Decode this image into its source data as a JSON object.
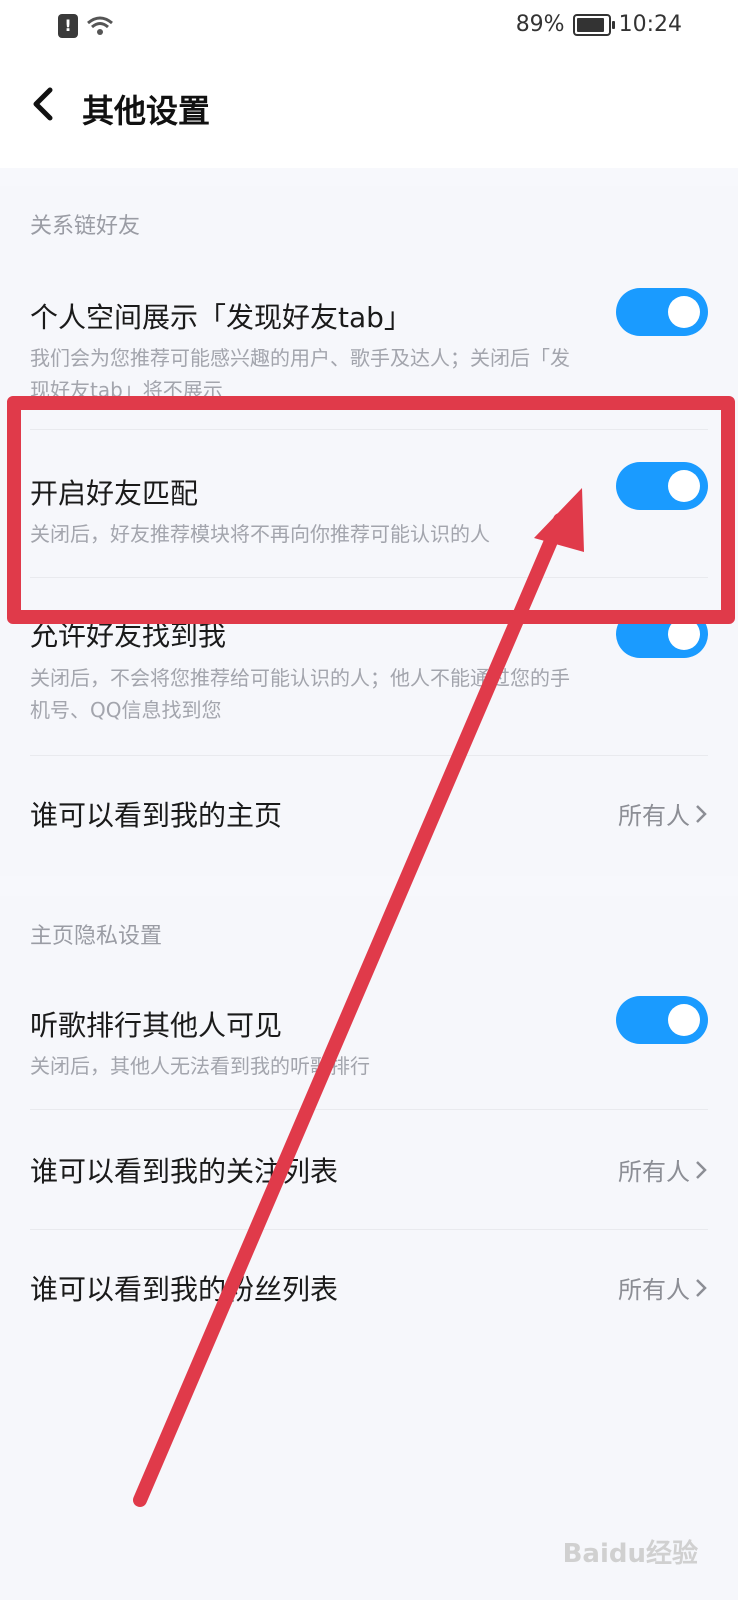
{
  "status_bar": {
    "battery": "89%",
    "battery_level": 0.89,
    "time": "10:24"
  },
  "header": {
    "title": "其他设置"
  },
  "sections": [
    {
      "header": "关系链好友",
      "rows": [
        {
          "title": "个人空间展示「发现好友tab」",
          "desc": "我们会为您推荐可能感兴趣的用户、歌手及达人；关闭后「发现好友tab」将不展示",
          "toggle": true
        },
        {
          "title": "开启好友匹配",
          "desc": "关闭后，好友推荐模块将不再向你推荐可能认识的人",
          "toggle": true
        },
        {
          "title": "允许好友找到我",
          "desc": "关闭后，不会将您推荐给可能认识的人；他人不能通过您的手机号、QQ信息找到您",
          "toggle": true
        },
        {
          "title": "谁可以看到我的主页",
          "value": "所有人"
        }
      ]
    },
    {
      "header": "主页隐私设置",
      "rows": [
        {
          "title": "听歌排行其他人可见",
          "desc": "关闭后，其他人无法看到我的听歌排行",
          "toggle": true
        },
        {
          "title": "谁可以看到我的关注列表",
          "value": "所有人"
        },
        {
          "title": "谁可以看到我的粉丝列表",
          "value": "所有人"
        }
      ]
    }
  ],
  "watermark": "Baidu经验",
  "colors": {
    "accent": "#1a9bff",
    "annotation": "#e03a4a"
  }
}
